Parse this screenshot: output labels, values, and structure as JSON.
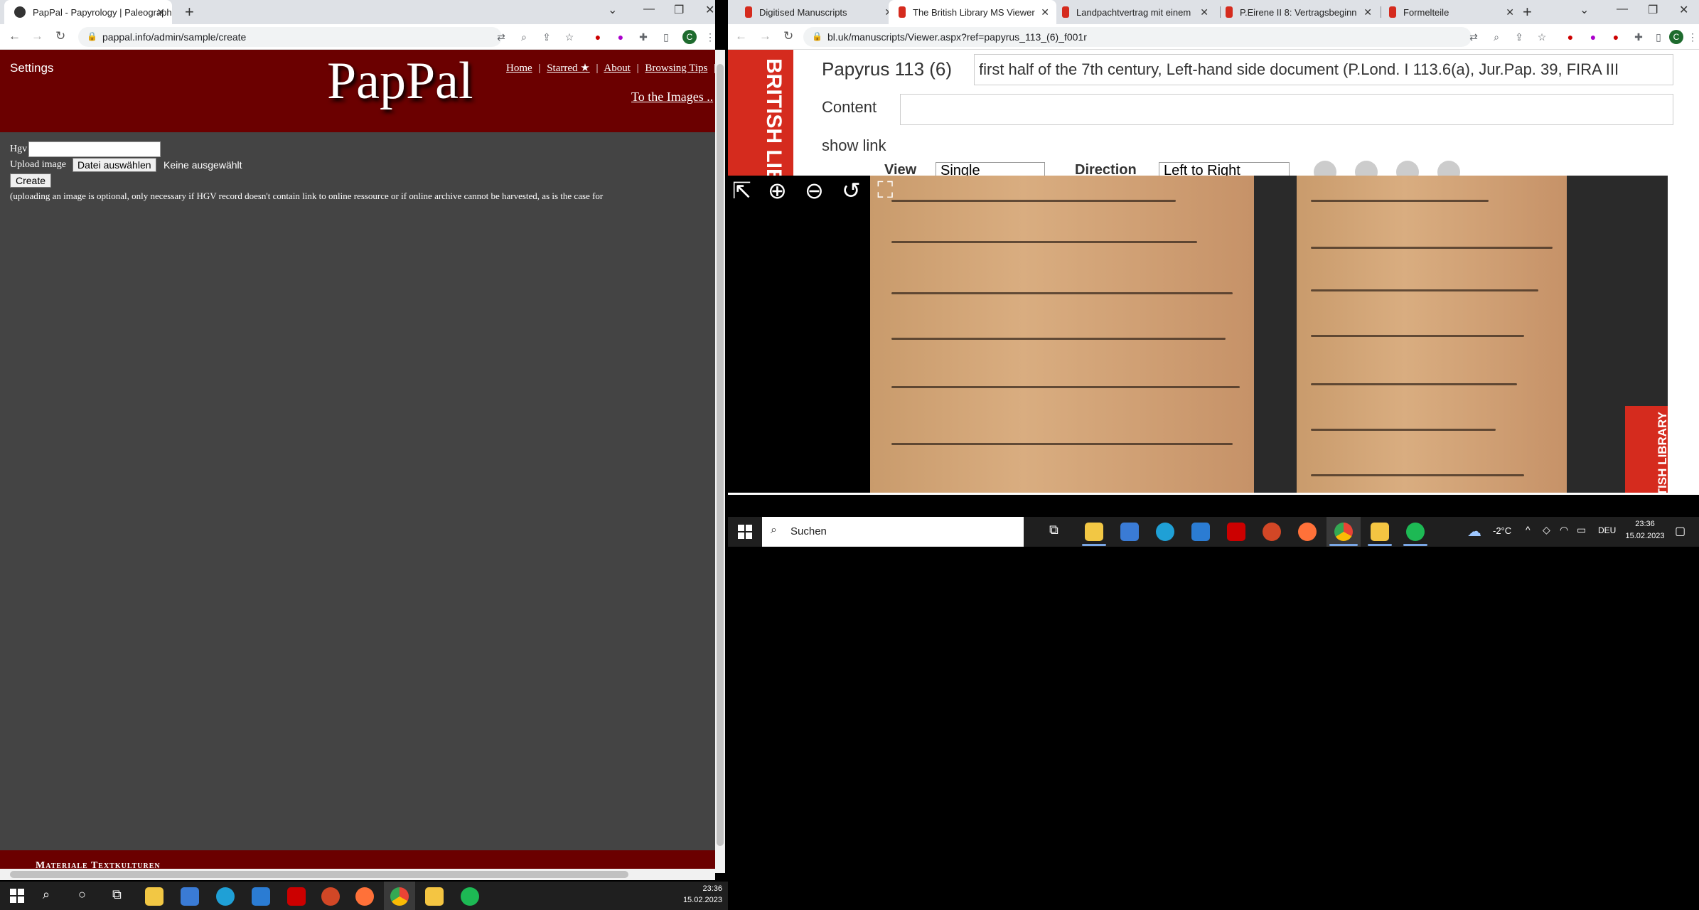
{
  "left_browser": {
    "tab_title": "PapPal - Papyrology | Paleograph",
    "url": "pappal.info/admin/sample/create",
    "page": {
      "settings_label": "Settings",
      "logo_text": "PapPal",
      "nav": [
        "Home",
        "Starred ★",
        "About",
        "Browsing Tips",
        "("
      ],
      "to_images_link": "To the Images ..",
      "hgv_label": "Hgv",
      "hgv_value": "",
      "upload_label": "Upload image",
      "file_button": "Datei auswählen",
      "file_status": "Keine ausgewählt",
      "create_button": "Create",
      "note": "(uploading an image is optional, only necessary if HGV record doesn't contain link to online ressource or if online archive cannot be harvested, as is the case for",
      "footer_text": "Materiale Textkulturen"
    }
  },
  "right_browser": {
    "tabs": [
      {
        "title": "Digitised Manuscripts",
        "active": false
      },
      {
        "title": "The British Library MS Viewer",
        "active": true
      },
      {
        "title": "Landpachtvertrag mit einem",
        "active": false
      },
      {
        "title": "P.Eirene II 8: Vertragsbeginn",
        "active": false
      },
      {
        "title": "Formelteile",
        "active": false
      }
    ],
    "url": "bl.uk/manuscripts/Viewer.aspx?ref=papyrus_113_(6)_f001r",
    "page": {
      "logo_text": "BRITISH LIBRARY",
      "title": "Papyrus 113 (6)",
      "description": "first half of the 7th century, Left-hand side document (P.Lond. I 113.6(a), Jur.Pap. 39, FIRA III",
      "content_label": "Content",
      "content_value": "",
      "show_link": "show link",
      "view_label": "View",
      "view_value": "Single",
      "direction_label": "Direction",
      "direction_value": "Left to Right",
      "watermark": "BRITISH LIBRARY"
    }
  },
  "taskbar_right": {
    "search_placeholder": "Suchen",
    "temp": "-2°C",
    "lang": "DEU",
    "time": "23:36",
    "date": "15.02.2023"
  },
  "taskbar_left": {
    "time": "23:36",
    "date": "15.02.2023"
  },
  "colors": {
    "pappal_red": "#6b0000",
    "bl_red": "#d52b1e",
    "papyrus": "#c99b6c"
  }
}
